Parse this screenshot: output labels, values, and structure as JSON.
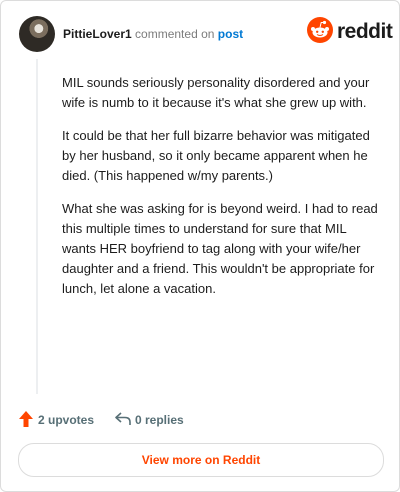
{
  "comment": {
    "username": "PittieLover1",
    "action_text": "commented on",
    "post_link": "post",
    "paragraphs": [
      "MIL sounds seriously personality disordered and your wife is numb to it because it's what she grew up with.",
      "It could be that her full bizarre behavior was mitigated by her husband, so it only became apparent when he died. (This happened w/my parents.)",
      "What she was asking for is beyond weird. I had to read this multiple times to understand for sure that MIL wants HER boyfriend to tag along with your wife/her daughter and a friend. This wouldn't be appropriate for lunch, let alone a vacation."
    ],
    "upvotes_label": "2 upvotes",
    "replies_label": "0 replies"
  },
  "brand": {
    "name": "reddit",
    "icon": "reddit-snoo-icon",
    "accent": "#ff4500"
  },
  "footer": {
    "view_more_label": "View more on Reddit"
  }
}
